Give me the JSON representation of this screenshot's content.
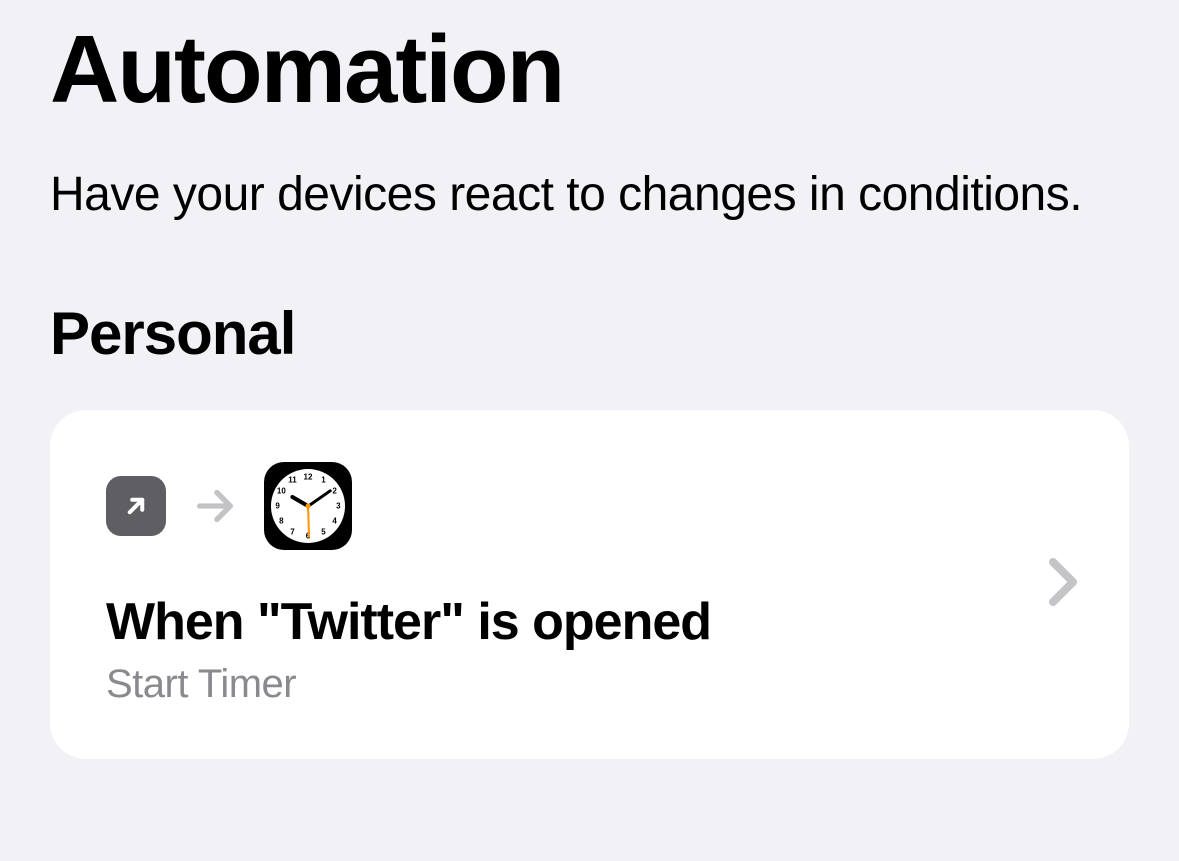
{
  "header": {
    "title": "Automation",
    "subtitle": "Have your devices react to changes in conditions."
  },
  "section": {
    "heading": "Personal"
  },
  "automations": [
    {
      "trigger_icon": "open-app-icon",
      "action_icon": "clock-icon",
      "title": "When \"Twitter\" is opened",
      "subtitle": "Start Timer"
    }
  ]
}
